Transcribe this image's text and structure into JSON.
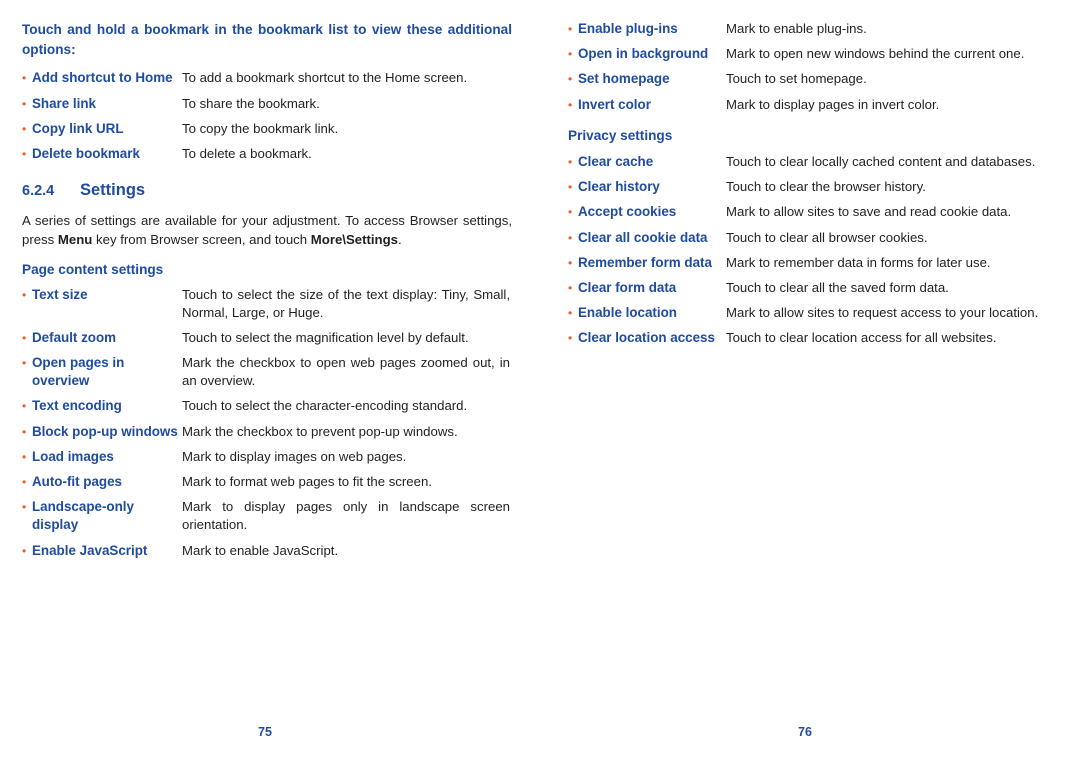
{
  "left_page": {
    "intro_heading": "Touch and hold a bookmark in the bookmark list to view these additional options:",
    "bookmark_options": [
      {
        "term": "Add shortcut to Home",
        "desc": "To add a bookmark shortcut to the Home screen."
      },
      {
        "term": "Share link",
        "desc": "To share the bookmark."
      },
      {
        "term": "Copy link URL",
        "desc": "To copy the bookmark link."
      },
      {
        "term": "Delete bookmark",
        "desc": "To delete a bookmark."
      }
    ],
    "section": {
      "number": "6.2.4",
      "title": "Settings"
    },
    "paragraph_parts": {
      "p1": "A series of settings are available for your adjustment. To access Browser settings, press ",
      "b1": "Menu",
      "p2": " key from Browser screen, and touch ",
      "b2": "More\\Settings",
      "p3": "."
    },
    "subheading": "Page content settings",
    "page_content_settings": [
      {
        "term": "Text size",
        "desc": "Touch to select the size of the text display: Tiny, Small, Normal, Large, or Huge."
      },
      {
        "term": "Default zoom",
        "desc": "Touch to select the magnification level by default."
      },
      {
        "term": "Open pages in overview",
        "desc": "Mark the checkbox to open web pages zoomed out, in an overview."
      },
      {
        "term": "Text encoding",
        "desc": "Touch to select the character-encoding standard."
      },
      {
        "term": "Block pop-up windows",
        "desc": "Mark the checkbox to prevent pop-up windows."
      },
      {
        "term": "Load images",
        "desc": "Mark to display images on web pages."
      },
      {
        "term": "Auto-fit pages",
        "desc": "Mark to format web pages to fit the screen."
      },
      {
        "term": "Landscape-only display",
        "desc": "Mark to display pages only in landscape screen orientation."
      },
      {
        "term": "Enable JavaScript",
        "desc": "Mark to enable JavaScript."
      }
    ],
    "page_number": "75"
  },
  "right_page": {
    "page_content_settings_cont": [
      {
        "term": "Enable plug-ins",
        "desc": "Mark to enable plug-ins."
      },
      {
        "term": "Open in background",
        "desc": "Mark to open new windows behind the current one."
      },
      {
        "term": "Set homepage",
        "desc": "Touch to set homepage."
      },
      {
        "term": "Invert color",
        "desc": "Mark to display pages in invert color."
      }
    ],
    "subheading": "Privacy settings",
    "privacy_settings": [
      {
        "term": "Clear cache",
        "desc": "Touch to clear locally cached content and databases."
      },
      {
        "term": "Clear history",
        "desc": "Touch to clear the browser history."
      },
      {
        "term": "Accept cookies",
        "desc": "Mark to allow sites to save and read cookie data."
      },
      {
        "term": "Clear all cookie data",
        "desc": "Touch to clear all browser cookies."
      },
      {
        "term": "Remember form data",
        "desc": "Mark to remember data in forms for later use."
      },
      {
        "term": "Clear form data",
        "desc": "Touch to clear all the saved form data."
      },
      {
        "term": "Enable location",
        "desc": "Mark to allow sites to request access to your location."
      },
      {
        "term": "Clear location access",
        "desc": "Touch to clear location access for all websites."
      }
    ],
    "page_number": "76"
  },
  "colors": {
    "heading_blue": "#1f4ba0",
    "bullet_orange": "#f15a22",
    "body_text": "#231f20"
  }
}
